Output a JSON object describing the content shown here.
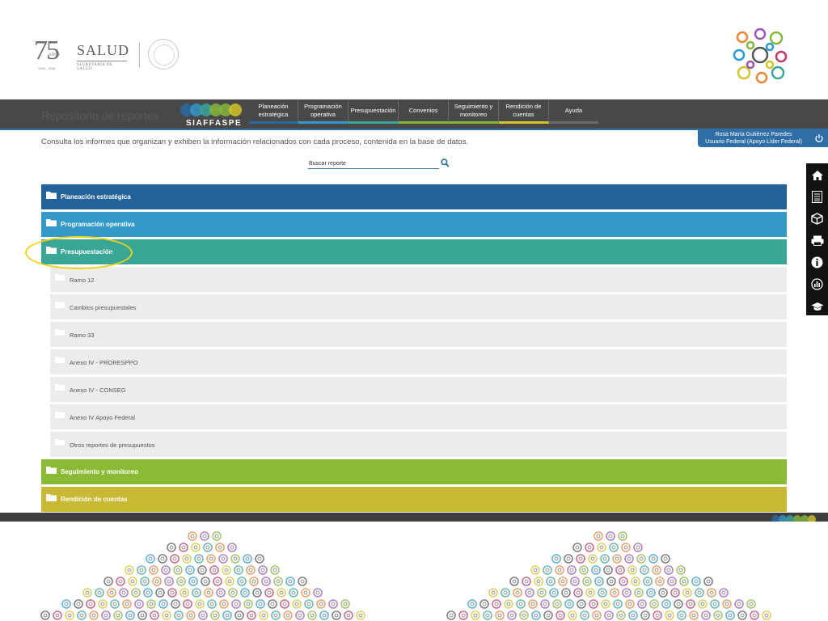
{
  "header": {
    "anniversary_number": "75",
    "anniversary_word": "AÑOS",
    "anniversary_years": "1943 - 2018",
    "brand": "SALUD",
    "brand_sub": "SECRETARÍA DE SALUD"
  },
  "nav": {
    "app_name": "SIAFFASPE",
    "hidden_page_title": "Repositorio de reportes",
    "items": [
      {
        "label": "Planeación estratégica",
        "accent": "#2a6aa2"
      },
      {
        "label": "Programación operativa",
        "accent": "#3498c9"
      },
      {
        "label": "Presupuestación",
        "accent": "#3aa69a"
      },
      {
        "label": "Convenios",
        "accent": "#86b63c"
      },
      {
        "label": "Seguimiento y monitoreo",
        "accent": "#86b63c"
      },
      {
        "label": "Rendición de cuentas",
        "accent": "#d4c42a"
      },
      {
        "label": "Ayuda",
        "accent": "#6a6a6a"
      }
    ]
  },
  "user": {
    "name": "Rosa María Gutiérrez Paredes",
    "role": "Usuario Federal (Apoyo Líder Federal)"
  },
  "main": {
    "description": "Consulta los informes que organizan y exhiben la información relacionados con cada proceso, contenida en la base de datos.",
    "search_placeholder": "Buscar reporte"
  },
  "accordion": {
    "sections": [
      {
        "label": "Planeación estratégica",
        "color": "#23629a"
      },
      {
        "label": "Programación operativa",
        "color": "#3399c8"
      },
      {
        "label": "Presupuestación",
        "color": "#3aa696"
      },
      {
        "label": "Seguimiento y monitoreo",
        "color": "#8bba35"
      },
      {
        "label": "Rendición de cuentas",
        "color": "#c9b834"
      }
    ],
    "expanded_section": "Presupuestación",
    "subitems": [
      "Ramo 12",
      "Cambios presupuestales",
      "Ramo 33",
      "Anexo IV - PRORESPPO",
      "Anexo IV - CONSEG",
      "Anexo IV Apoyo Federal",
      "Otros reportes de presupuestos"
    ]
  },
  "side_toolbar": [
    "home-icon",
    "list-icon",
    "cube-icon",
    "printer-icon",
    "info-icon",
    "chart-icon",
    "graduation-cap-icon"
  ],
  "colors": {
    "highlight": "#f0d21a",
    "navbar": "#484848",
    "user_tag": "#2f6ea6"
  }
}
